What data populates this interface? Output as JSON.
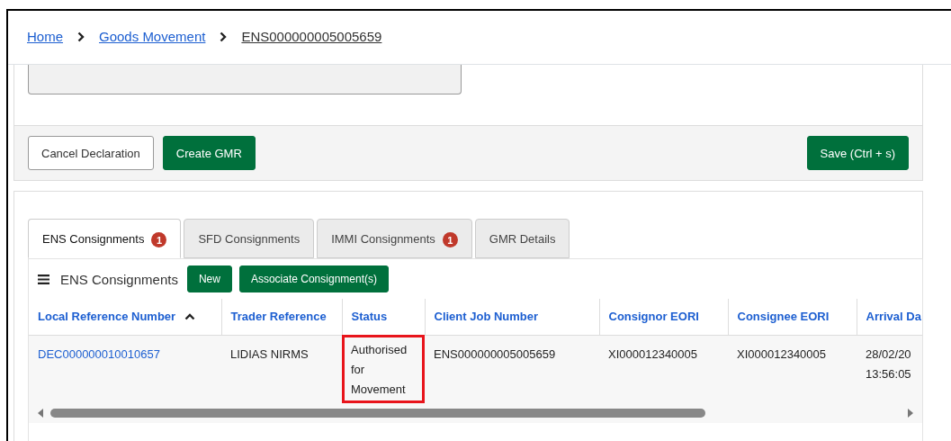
{
  "breadcrumb": [
    {
      "label": "Home",
      "current": false
    },
    {
      "label": "Goods Movement",
      "current": false
    },
    {
      "label": "ENS000000005005659",
      "current": true
    }
  ],
  "actions": [
    {
      "label": "Cancel Declaration",
      "kind": "secondary"
    },
    {
      "label": "Create GMR",
      "kind": "primary"
    },
    {
      "label": "Save (Ctrl + s)",
      "kind": "primary"
    }
  ],
  "tabs": [
    {
      "label": "ENS Consignments",
      "badge": "1",
      "selected": true
    },
    {
      "label": "SFD Consignments",
      "selected": false
    },
    {
      "label": "IMMI Consignments",
      "badge": "1",
      "selected": false
    },
    {
      "label": "GMR Details",
      "selected": false
    }
  ],
  "grid": {
    "title": "ENS Consignments",
    "buttons": [
      "New",
      "Associate Consignment(s)"
    ],
    "columns": [
      {
        "label": "Local Reference Number",
        "sorted": true
      },
      {
        "label": "Trader Reference"
      },
      {
        "label": "Status"
      },
      {
        "label": "Client Job Number"
      },
      {
        "label": "Consignor EORI"
      },
      {
        "label": "Consignee EORI"
      },
      {
        "label": "Arrival Da"
      }
    ],
    "rows": [
      {
        "cells": [
          {
            "text": "DEC000000010010657",
            "kind": "link"
          },
          {
            "text": "LIDIAS NIRMS"
          },
          {
            "text": "Authorised for Movement",
            "highlighted": true
          },
          {
            "text": "ENS000000005005659"
          },
          {
            "text": "XI000012340005"
          },
          {
            "text": "XI000012340005"
          },
          {
            "lines": [
              "28/02/20",
              "13:56:05"
            ]
          }
        ]
      }
    ]
  }
}
